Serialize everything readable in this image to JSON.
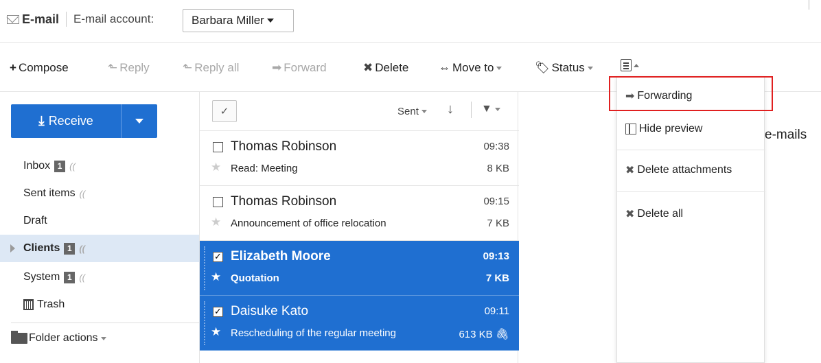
{
  "header": {
    "app_name": "E-mail",
    "account_label": "E-mail account:",
    "account_value": "Barbara Miller"
  },
  "toolbar": {
    "compose": "Compose",
    "reply": "Reply",
    "reply_all": "Reply all",
    "forward": "Forward",
    "delete": "Delete",
    "move_to": "Move to",
    "status": "Status"
  },
  "sidebar": {
    "receive": "Receive",
    "folders": [
      {
        "label": "Inbox",
        "badge": "1"
      },
      {
        "label": "Sent items",
        "badge": ""
      },
      {
        "label": "Draft",
        "badge": ""
      },
      {
        "label": "Clients",
        "badge": "1"
      },
      {
        "label": "System",
        "badge": "1"
      },
      {
        "label": "Trash",
        "badge": ""
      }
    ],
    "folder_actions": "Folder actions"
  },
  "list": {
    "sort_label": "Sent",
    "messages": [
      {
        "from": "Thomas Robinson",
        "time": "09:38",
        "subject": "Read: Meeting",
        "size": "8 KB"
      },
      {
        "from": "Thomas Robinson",
        "time": "09:15",
        "subject": "Announcement of office relocation",
        "size": "7 KB"
      },
      {
        "from": "Elizabeth Moore",
        "time": "09:13",
        "subject": "Quotation",
        "size": "7 KB"
      },
      {
        "from": "Daisuke Kato",
        "time": "09:11",
        "subject": "Rescheduling of the regular meeting",
        "size": "613 KB"
      }
    ]
  },
  "preview": {
    "partial_text": "e-mails"
  },
  "menu": {
    "forwarding": "Forwarding",
    "hide_preview": "Hide preview",
    "delete_attachments": "Delete attachments",
    "delete_all": "Delete all"
  },
  "colors": {
    "accent": "#1f6fd1",
    "selected_folder": "#dde8f5",
    "highlight": "#e02020"
  }
}
